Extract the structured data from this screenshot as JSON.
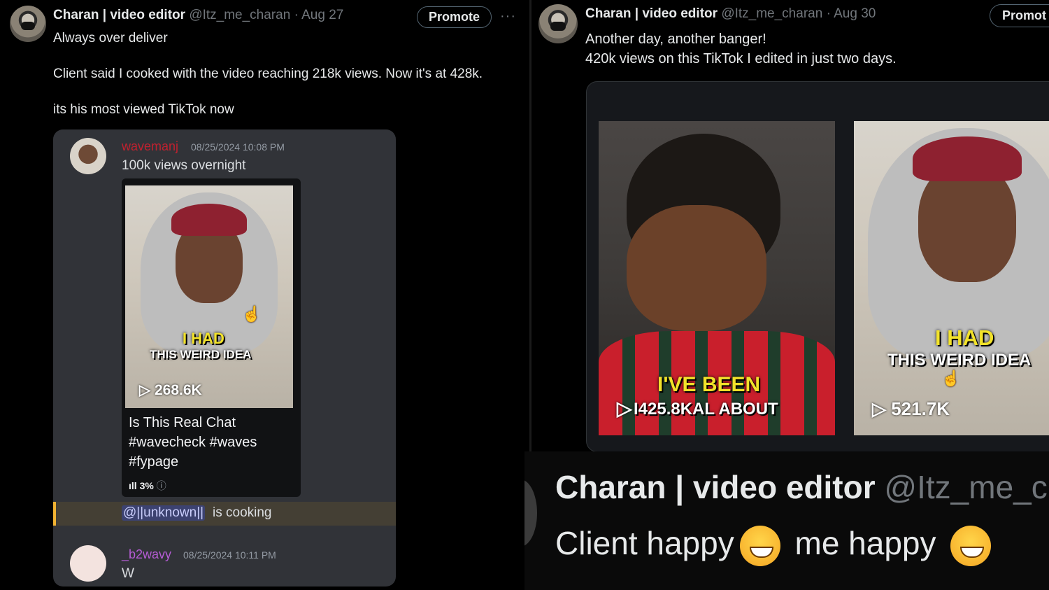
{
  "left_tweet": {
    "name": "Charan | video editor",
    "handle": "@Itz_me_charan",
    "separator": "·",
    "date": "Aug 27",
    "promote_label": "Promote",
    "more_label": "···",
    "lines": [
      "Always over deliver",
      "Client said I cooked with the video reaching 218k views. Now it's at 428k.",
      "its his most viewed TikTok now"
    ],
    "discord": {
      "msg1": {
        "username": "wavemanj",
        "username_color": "#c0212f",
        "timestamp": "08/25/2024 10:08 PM",
        "text": "100k views overnight"
      },
      "embed": {
        "caption_yellow": "I HAD",
        "caption_white": "THIS WEIRD IDEA",
        "views": "268.6K",
        "title": "Is This Real Chat #wavecheck #waves #fypage",
        "stat": "3%"
      },
      "mention": {
        "mention_text": "@||unknown||",
        "rest": "is cooking"
      },
      "msg2": {
        "username": "_b2wavy",
        "username_color": "#b65cd6",
        "timestamp": "08/25/2024 10:11 PM",
        "text": "W"
      }
    }
  },
  "right_tweet": {
    "name": "Charan | video editor",
    "handle": "@Itz_me_charan",
    "separator": "·",
    "date": "Aug 30",
    "promote_label": "Promot",
    "lines": [
      "Another day, another banger!",
      "420k views on this TikTok I edited in just two days."
    ],
    "videos": [
      {
        "caption_top": "I'VE BEEN",
        "caption_bottom": "I425.8KAL ABOUT"
      },
      {
        "caption_yellow": "I HAD",
        "caption_white": "THIS WEIRD IDEA",
        "views": "521.7K"
      }
    ]
  },
  "bottom_tweet": {
    "name": "Charan | video editor",
    "handle": "@Itz_me_c",
    "text_part1": "Client happy",
    "text_part2": " me happy "
  }
}
